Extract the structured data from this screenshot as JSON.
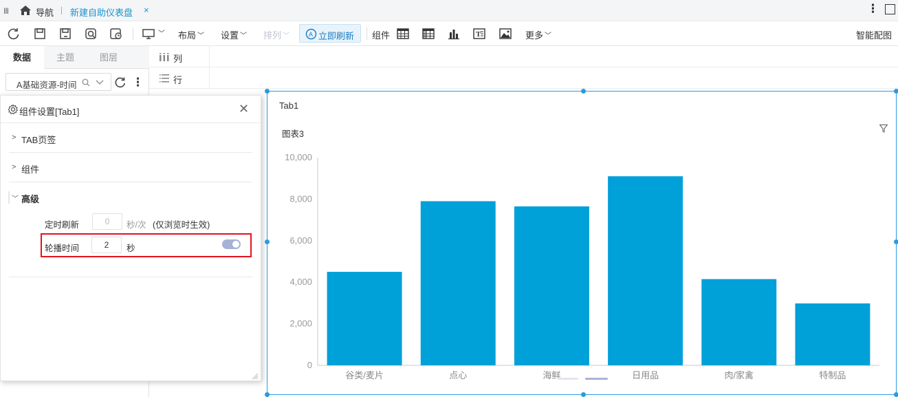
{
  "titlebar": {
    "nav_label": "导航",
    "tab_label": "新建自助仪表盘",
    "tab_close": "×"
  },
  "toolbar": {
    "layout": "布局",
    "settings": "设置",
    "arrange": "排列",
    "refresh": "立即刷新",
    "component": "组件",
    "more": "更多",
    "smart_color": "智能配图"
  },
  "left": {
    "tabs": [
      "数据",
      "主题",
      "图层"
    ],
    "datasource": "A基础资源-时间"
  },
  "fields": {
    "columns": "列",
    "rows": "行"
  },
  "settings_panel": {
    "title": "组件设置[Tab1]",
    "sections": [
      "TAB页签",
      "组件",
      "高级"
    ],
    "refresh_label": "定时刷新",
    "refresh_value": "0",
    "refresh_unit": "秒/次",
    "refresh_note": "(仅浏览时生效)",
    "carousel_label": "轮播时间",
    "carousel_value": "2",
    "carousel_unit": "秒",
    "carousel_enabled": true
  },
  "canvas": {
    "tab_name": "Tab1",
    "chart_name": "图表3"
  },
  "chart_data": {
    "type": "bar",
    "categories": [
      "谷类/麦片",
      "点心",
      "海鲜",
      "日用品",
      "肉/家禽",
      "特制品"
    ],
    "values": [
      4500,
      7900,
      7650,
      9100,
      4150,
      2980
    ],
    "ylim": [
      0,
      10000
    ],
    "yticks": [
      "0",
      "2,000",
      "4,000",
      "6,000",
      "8,000",
      "10,000"
    ],
    "bar_color": "#00a0d9",
    "grid": false
  },
  "colors": {
    "accent": "#1a94d1",
    "selection": "#2a9be0",
    "highlight": "#e0141e"
  }
}
